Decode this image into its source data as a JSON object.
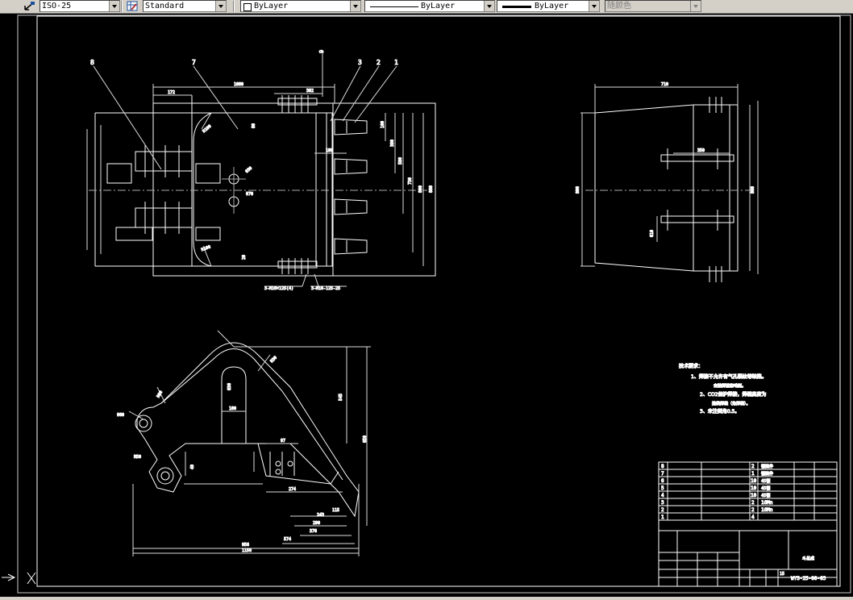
{
  "toolbar": {
    "dimstyle": "ISO-25",
    "tablestyle": "Standard",
    "layer": "ByLayer",
    "linetype": "ByLayer",
    "lineweight": "ByLayer",
    "plotstyle": "随颜色"
  },
  "drawing": {
    "top_view": {
      "label_1": "1",
      "label_2": "2",
      "label_3": "3",
      "label_7": "7",
      "label_8": "8",
      "label_9": "9",
      "dim_1080": "1080",
      "dim_172": "172",
      "dim_382": "382",
      "dim_180": "180",
      "dim_100": "100",
      "dim_390": "390",
      "dim_580": "580",
      "dim_730": "730",
      "dim_800": "800",
      "dim_860": "860",
      "dim_r100_a": "R100",
      "dim_r100_b": "R100",
      "dim_20": "20",
      "dim_80": "80",
      "dim_d30": "Φ30",
      "dim_d70": "Φ70",
      "note_bolt_1": "3-M16×125(4)",
      "note_bolt_2": "3-M16-125-25"
    },
    "side_view": {
      "dim_710": "710",
      "dim_350": "350",
      "dim_800": "800",
      "dim_860": "860",
      "dim_610": "610"
    },
    "front_view": {
      "dim_545": "545",
      "dim_650": "650",
      "dim_180": "180",
      "dim_40": "40",
      "dim_97": "97",
      "dim_274": "274",
      "dim_115": "115",
      "dim_243": "243",
      "dim_290": "290",
      "dim_376": "376",
      "dim_574": "574",
      "dim_956": "956",
      "dim_1156": "1156",
      "dim_r30": "R30",
      "dim_d30": "Φ30",
      "dim_r90": "R90",
      "dim_d60": "Φ60",
      "dim_r50": "R50"
    },
    "notes": {
      "title": "技术要求：",
      "line1": "1、焊接不允许有气孔裂纹等缺陷。",
      "line1b": "去除焊渣和毛刺。",
      "line2": "2、CO2保护焊接，焊缝高度为",
      "line2b": "连续焊缝（角焊缝）。",
      "line3": "3、未注倒角0.5。"
    },
    "parts_list": [
      {
        "no": "8",
        "name": "",
        "qty": "2",
        "mat": "钢铸件"
      },
      {
        "no": "7",
        "name": "",
        "qty": "1",
        "mat": "钢铸件"
      },
      {
        "no": "6",
        "name": "",
        "qty": "10",
        "mat": "45钢"
      },
      {
        "no": "5",
        "name": "",
        "qty": "10",
        "mat": "45钢"
      },
      {
        "no": "4",
        "name": "",
        "qty": "10",
        "mat": "45钢"
      },
      {
        "no": "3",
        "name": "",
        "qty": "2",
        "mat": "16Mn"
      },
      {
        "no": "2",
        "name": "",
        "qty": "2",
        "mat": "16Mn"
      },
      {
        "no": "1",
        "name": "",
        "qty": "4",
        "mat": ""
      }
    ],
    "title_block": {
      "drawing_no": "WYS-25-00-03",
      "scale_val": "15",
      "name": "斗总成"
    }
  }
}
